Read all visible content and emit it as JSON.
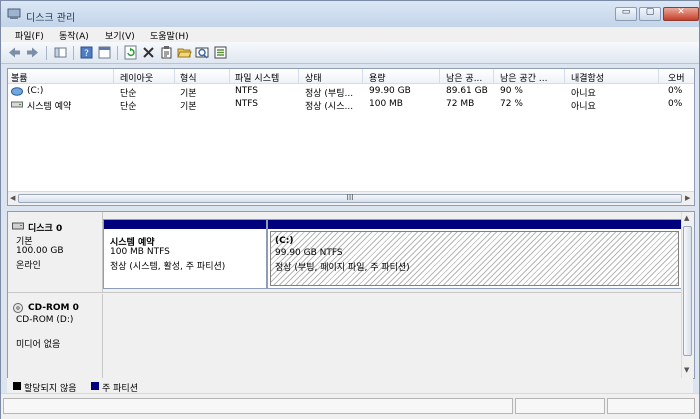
{
  "window": {
    "title": "디스크 관리",
    "controls": {
      "minimize": "▭",
      "maximize": "▢",
      "close": "✕"
    }
  },
  "menu": [
    "파일(F)",
    "동작(A)",
    "보기(V)",
    "도움말(H)"
  ],
  "toolbar": {
    "icons": [
      "back-icon",
      "forward-icon",
      "console-tree-icon",
      "help-icon",
      "console-icon",
      "refresh-icon",
      "delete-icon",
      "properties-icon",
      "open-icon",
      "rescan-icon",
      "wizard-icon"
    ]
  },
  "volume_list": {
    "columns": [
      "볼륨",
      "레이아웃",
      "형식",
      "파일 시스템",
      "상태",
      "용량",
      "남은 공...",
      "남은 공간 ...",
      "내결함성",
      "오버"
    ],
    "rows": [
      {
        "volume": "(C:)",
        "layout": "단순",
        "type": "기본",
        "fs": "NTFS",
        "status": "정상 (부팅...",
        "capacity": "99.90 GB",
        "free": "89.61 GB",
        "free_pct": "90 %",
        "fault": "아니요",
        "overhead": "0%"
      },
      {
        "volume": "시스템 예약",
        "layout": "단순",
        "type": "기본",
        "fs": "NTFS",
        "status": "정상 (시스...",
        "capacity": "100 MB",
        "free": "72 MB",
        "free_pct": "72 %",
        "fault": "아니요",
        "overhead": "0%"
      }
    ],
    "scroll_grip": "III"
  },
  "disks": [
    {
      "name": "디스크 0",
      "kind": "기본",
      "size": "100.00 GB",
      "state": "온라인",
      "partitions": [
        {
          "name": "시스템 예약",
          "size_fs": "100 MB NTFS",
          "status": "정상 (시스템, 활성, 주 파티션)"
        },
        {
          "name": "(C:)",
          "size_fs": "99.90 GB NTFS",
          "status": "정상 (부팅, 페이지 파일, 주 파티션)"
        }
      ]
    },
    {
      "name": "CD-ROM 0",
      "kind": "CD-ROM (D:)",
      "state": "미디어 없음"
    }
  ],
  "legend": [
    {
      "label": "할당되지 않음",
      "color": "#000000"
    },
    {
      "label": "주 파티션",
      "color": "#00007f"
    }
  ]
}
